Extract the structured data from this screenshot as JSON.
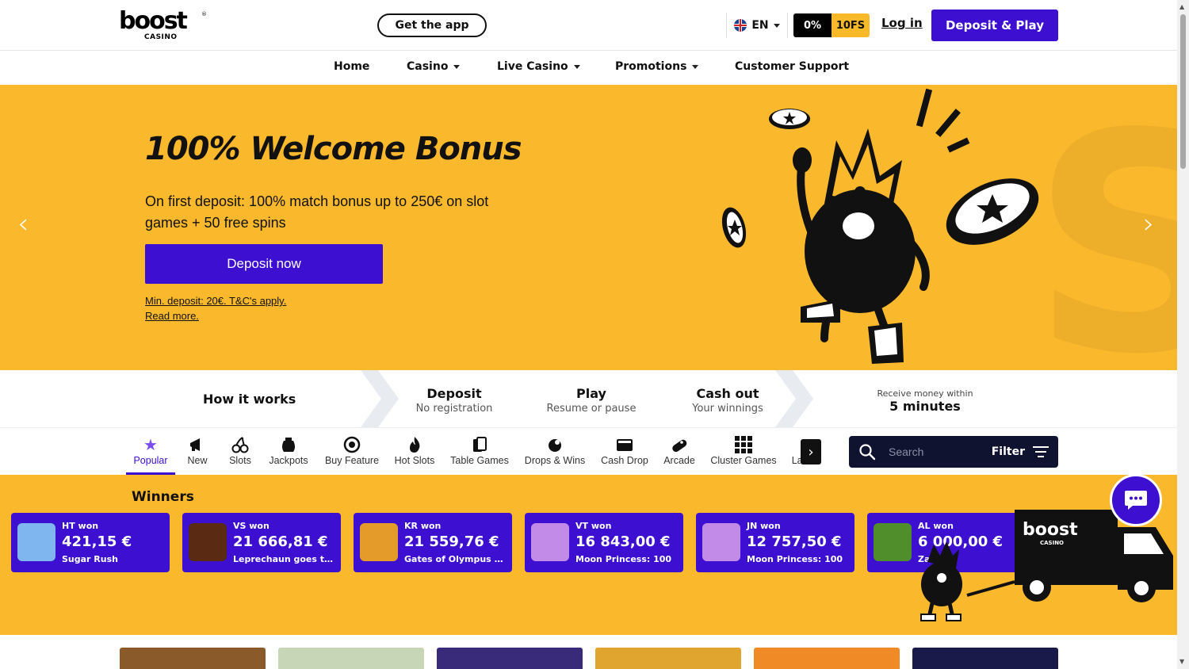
{
  "header": {
    "logo_text": "boost",
    "logo_sub": "CASINO",
    "get_app": "Get the app",
    "lang": "EN",
    "promo_pct": "0%",
    "promo_fs": "10FS",
    "login": "Log in",
    "deposit_play": "Deposit & Play"
  },
  "nav": {
    "home": "Home",
    "casino": "Casino",
    "live_casino": "Live Casino",
    "promotions": "Promotions",
    "support": "Customer Support"
  },
  "hero": {
    "title": "100% Welcome Bonus",
    "description": "On first deposit: 100% match bonus up to 250€ on slot games + 50 free spins",
    "cta": "Deposit now",
    "terms": "Min. deposit: 20€. T&C's apply.",
    "read_more": "Read more."
  },
  "how": {
    "title": "How it works",
    "steps": [
      {
        "head": "Deposit",
        "sub": "No registration"
      },
      {
        "head": "Play",
        "sub": "Resume or pause"
      },
      {
        "head": "Cash out",
        "sub": "Your winnings"
      }
    ],
    "receive_label": "Receive money within",
    "receive_value": "5 minutes"
  },
  "categories": [
    {
      "label": "Popular",
      "icon": "star-icon",
      "active": true
    },
    {
      "label": "New",
      "icon": "megaphone-icon"
    },
    {
      "label": "Slots",
      "icon": "cherries-icon"
    },
    {
      "label": "Jackpots",
      "icon": "moneybag-icon"
    },
    {
      "label": "Buy Feature",
      "icon": "buy-icon"
    },
    {
      "label": "Hot Slots",
      "icon": "flame-icon"
    },
    {
      "label": "Table Games",
      "icon": "cards-icon"
    },
    {
      "label": "Drops & Wins",
      "icon": "gift-icon"
    },
    {
      "label": "Cash Drop",
      "icon": "wallet-icon"
    },
    {
      "label": "Arcade",
      "icon": "gamepad-icon"
    },
    {
      "label": "Cluster Games",
      "icon": "grid-icon"
    },
    {
      "label": "Lates",
      "icon": "clock-icon"
    }
  ],
  "search": {
    "placeholder": "Search",
    "filter": "Filter"
  },
  "winners": {
    "title": "Winners",
    "items": [
      {
        "who": "HT won",
        "amount": "421,15 €",
        "game": "Sugar Rush",
        "thumb": "#7fb6ef"
      },
      {
        "who": "VS won",
        "amount": "21 666,81 €",
        "game": "Leprechaun goes to ...",
        "thumb": "#5a2a12"
      },
      {
        "who": "KR won",
        "amount": "21 559,76 €",
        "game": "Gates of Olympus Su...",
        "thumb": "#e49b2a"
      },
      {
        "who": "VT won",
        "amount": "16 843,00 €",
        "game": "Moon Princess: 100",
        "thumb": "#c38be8"
      },
      {
        "who": "JN won",
        "amount": "12 757,50 €",
        "game": "Moon Princess: 100",
        "thumb": "#c38be8"
      },
      {
        "who": "AL won",
        "amount": "6 000,00 €",
        "game": "Za...",
        "thumb": "#4f8e2a"
      }
    ]
  },
  "truck_logo": "boost",
  "truck_sub": "CASINO",
  "tiles": [
    {
      "color": "#8b5a2b"
    },
    {
      "color": "#c7d6b7"
    },
    {
      "color": "#3a2b7a"
    },
    {
      "color": "#e0a52e"
    },
    {
      "color": "#f08a26"
    },
    {
      "color": "#1a1a4a"
    }
  ]
}
